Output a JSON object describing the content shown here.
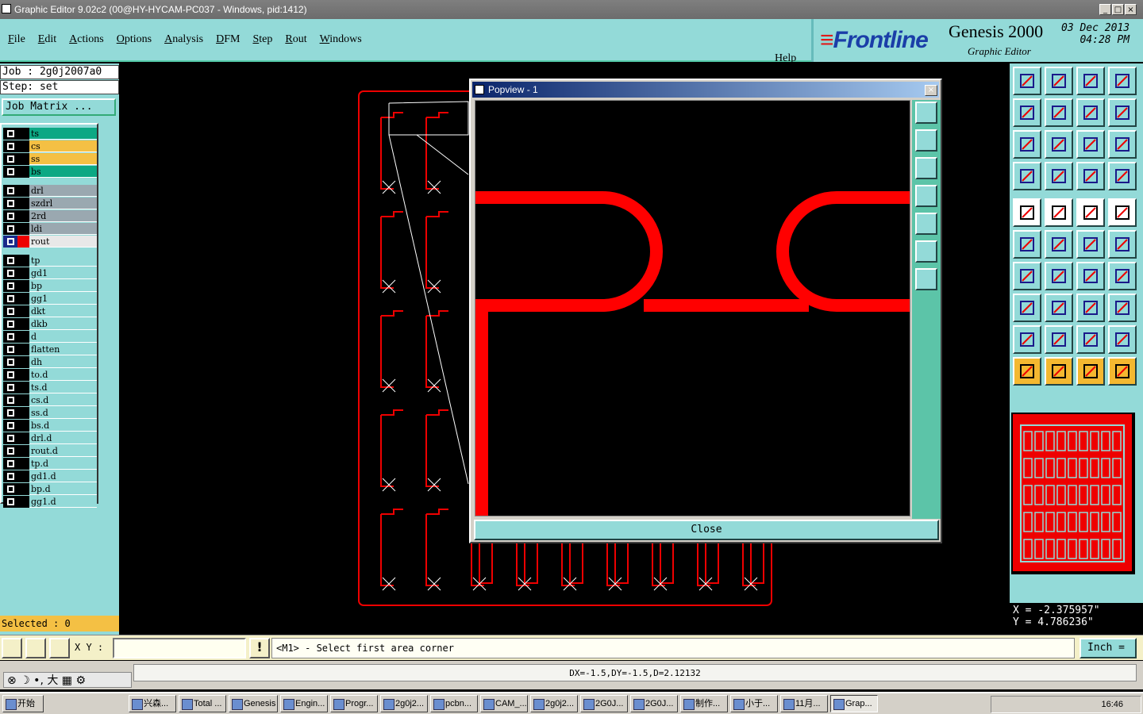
{
  "window": {
    "title": "Graphic Editor 9.02c2 (00@HY-HYCAM-PC037 - Windows, pid:1412)"
  },
  "menu": [
    "File",
    "Edit",
    "Actions",
    "Options",
    "Analysis",
    "DFM",
    "Step",
    "Rout",
    "Windows"
  ],
  "help": "Help",
  "brand": {
    "logo_pre": "",
    "logo_main": "Frontline",
    "product": "Genesis 2000",
    "subtitle": "Graphic Editor",
    "date": "03 Dec 2013",
    "time": "04:28 PM"
  },
  "job": {
    "job_line": "Job : 2g0j2007a0",
    "step_line": "Step: set",
    "matrix_button": "Job Matrix ..."
  },
  "layers": [
    {
      "name": "ts",
      "color": "#0ca884"
    },
    {
      "name": "cs",
      "color": "#f4c044"
    },
    {
      "name": "ss",
      "color": "#f4c044"
    },
    {
      "name": "bs",
      "color": "#0ca884"
    },
    {
      "name": "drl",
      "color": "#9aa8b0"
    },
    {
      "name": "szdrl",
      "color": "#9aa8b0"
    },
    {
      "name": "2rd",
      "color": "#9aa8b0"
    },
    {
      "name": "ldi",
      "color": "#9aa8b0"
    },
    {
      "name": "rout",
      "color": "#e8e8e8",
      "active": true
    },
    {
      "name": "tp",
      "color": "#93dad8"
    },
    {
      "name": "gd1",
      "color": "#93dad8"
    },
    {
      "name": "bp",
      "color": "#93dad8"
    },
    {
      "name": "gg1",
      "color": "#93dad8"
    },
    {
      "name": "dkt",
      "color": "#93dad8"
    },
    {
      "name": "dkb",
      "color": "#93dad8"
    },
    {
      "name": "d",
      "color": "#93dad8"
    },
    {
      "name": "flatten",
      "color": "#93dad8"
    },
    {
      "name": "dh",
      "color": "#93dad8"
    },
    {
      "name": "to.d",
      "color": "#93dad8"
    },
    {
      "name": "ts.d",
      "color": "#93dad8"
    },
    {
      "name": "cs.d",
      "color": "#93dad8"
    },
    {
      "name": "ss.d",
      "color": "#93dad8"
    },
    {
      "name": "bs.d",
      "color": "#93dad8"
    },
    {
      "name": "drl.d",
      "color": "#93dad8"
    },
    {
      "name": "rout.d",
      "color": "#93dad8"
    },
    {
      "name": "tp.d",
      "color": "#93dad8"
    },
    {
      "name": "gd1.d",
      "color": "#93dad8"
    },
    {
      "name": "bp.d",
      "color": "#93dad8"
    },
    {
      "name": "gg1.d",
      "color": "#93dad8"
    }
  ],
  "selected": "Selected : 0",
  "popup": {
    "title": "Popview - 1",
    "close_label": "Close"
  },
  "coords": {
    "x": "X = -2.375957\"",
    "y": "Y = 4.786236\""
  },
  "cmd": {
    "xy_label": "X Y :",
    "xy_value": "",
    "prompt": "<M1> - Select first area corner",
    "units": "Inch"
  },
  "status": {
    "dxy": "DX=-1.5,DY=-1.5,D=2.12132"
  },
  "taskbar": {
    "start": "开始",
    "items": [
      "兴森...",
      "Total ...",
      "Genesis",
      "Engin...",
      "Progr...",
      "2g0j2...",
      "pcbn...",
      "CAM_...",
      "2g0j2...",
      "2G0J...",
      "2G0J...",
      "制作...",
      "小于...",
      "11月...",
      "Grap..."
    ],
    "clock": "16:46"
  },
  "colors": {
    "panel": "#93dad8",
    "rout": "#ff0000"
  }
}
